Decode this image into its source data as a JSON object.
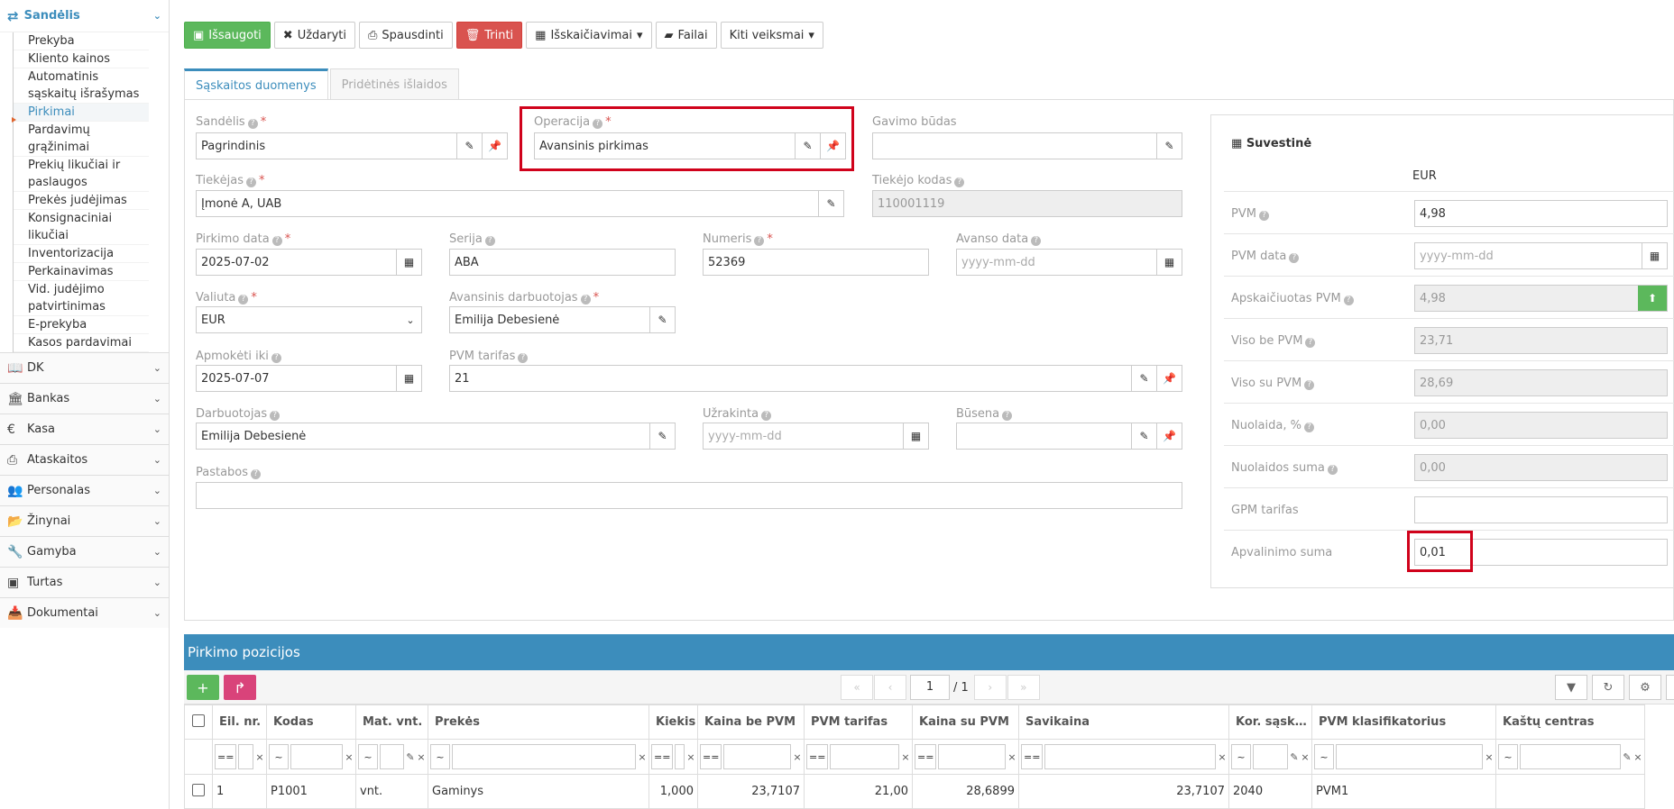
{
  "sidebar": {
    "section_title": "Sandėlis",
    "items": [
      {
        "label": "Prekyba"
      },
      {
        "label": "Kliento kainos"
      },
      {
        "label": "Automatinis sąskaitų išrašymas"
      },
      {
        "label": "Pirkimai",
        "active": true
      },
      {
        "label": "Pardavimų grąžinimai"
      },
      {
        "label": "Prekių likučiai ir paslaugos"
      },
      {
        "label": "Prekės judėjimas"
      },
      {
        "label": "Konsignaciniai likučiai"
      },
      {
        "label": "Inventorizacija"
      },
      {
        "label": "Perkainavimas"
      },
      {
        "label": "Vid. judėjimo patvirtinimas"
      },
      {
        "label": "E-prekyba"
      },
      {
        "label": "Kasos pardavimai"
      }
    ],
    "modules": [
      {
        "label": "DK",
        "icon": "book-icon"
      },
      {
        "label": "Bankas",
        "icon": "bank-icon"
      },
      {
        "label": "Kasa",
        "icon": "euro-icon"
      },
      {
        "label": "Ataskaitos",
        "icon": "print-icon"
      },
      {
        "label": "Personalas",
        "icon": "users-icon"
      },
      {
        "label": "Žinynai",
        "icon": "folder-open-icon"
      },
      {
        "label": "Gamyba",
        "icon": "wrench-icon"
      },
      {
        "label": "Turtas",
        "icon": "cube-icon"
      },
      {
        "label": "Dokumentai",
        "icon": "inbox-icon"
      }
    ]
  },
  "toolbar": {
    "save": "Išsaugoti",
    "close": "Uždaryti",
    "print": "Spausdinti",
    "delete": "Trinti",
    "calc": "Išskaičiavimai",
    "files": "Failai",
    "more": "Kiti veiksmai"
  },
  "tabs": {
    "main": "Sąskaitos duomenys",
    "extra": "Pridėtinės išlaidos"
  },
  "form": {
    "warehouse_label": "Sandėlis",
    "warehouse": "Pagrindinis",
    "operation_label": "Operacija",
    "operation": "Avansinis pirkimas",
    "delivery_label": "Gavimo būdas",
    "delivery": "",
    "supplier_label": "Tiekėjas",
    "supplier": "Įmonė A, UAB",
    "supplier_code_label": "Tiekėjo kodas",
    "supplier_code": "110001119",
    "purchase_date_label": "Pirkimo data",
    "purchase_date": "2025-07-02",
    "series_label": "Serija",
    "series": "ABA",
    "number_label": "Numeris",
    "number": "52369",
    "advance_date_label": "Avanso data",
    "date_placeholder": "yyyy-mm-dd",
    "currency_label": "Valiuta",
    "currency": "EUR",
    "advance_employee_label": "Avansinis darbuotojas",
    "advance_employee": "Emilija Debesienė",
    "pay_until_label": "Apmokėti iki",
    "pay_until": "2025-07-07",
    "vat_rate_label": "PVM tarifas",
    "vat_rate": "21",
    "employee_label": "Darbuotojas",
    "employee": "Emilija Debesienė",
    "locked_label": "Užrakinta",
    "status_label": "Būsena",
    "status": "",
    "notes_label": "Pastabos",
    "notes": ""
  },
  "summary": {
    "title": "Suvestinė",
    "currency": "EUR",
    "rows": [
      {
        "label": "PVM",
        "value": "4,98"
      },
      {
        "label": "PVM data",
        "value": "yyyy-mm-dd"
      },
      {
        "label": "Apskaičiuotas PVM",
        "value": "4,98"
      },
      {
        "label": "Viso be PVM",
        "value": "23,71"
      },
      {
        "label": "Viso su PVM",
        "value": "28,69"
      },
      {
        "label": "Nuolaida, %",
        "value": "0,00"
      },
      {
        "label": "Nuolaidos suma",
        "value": "0,00"
      },
      {
        "label": "GPM tarifas",
        "value": ""
      },
      {
        "label": "Apvalinimo suma",
        "value": "0,01"
      }
    ]
  },
  "positions": {
    "title": "Pirkimo pozicijos",
    "page": "1",
    "page_total": "/ 1",
    "columns": [
      "Eil. nr.",
      "Kodas",
      "Mat. vnt.",
      "Prekės",
      "Kiekis",
      "Kaina be PVM",
      "PVM tarifas",
      "Kaina su PVM",
      "Savikaina",
      "Kor. sąsk…",
      "PVM klasifikatorius",
      "Kaštų centras"
    ],
    "filter_ops": {
      "eq": "==",
      "like": "~"
    },
    "rows": [
      {
        "nr": "1",
        "code": "P1001",
        "unit": "vnt.",
        "item": "Gaminys",
        "qty": "1,000",
        "price": "23,7107",
        "vat": "21,00",
        "price_vat": "28,6899",
        "cost": "23,7107",
        "account": "2040",
        "vat_class": "PVM1",
        "cost_center": ""
      }
    ]
  },
  "colors": {
    "accent": "#3c8dbc",
    "green": "#5cb85c",
    "red": "#d9534f",
    "highlight": "#d0021b",
    "pink": "#d9437a"
  }
}
